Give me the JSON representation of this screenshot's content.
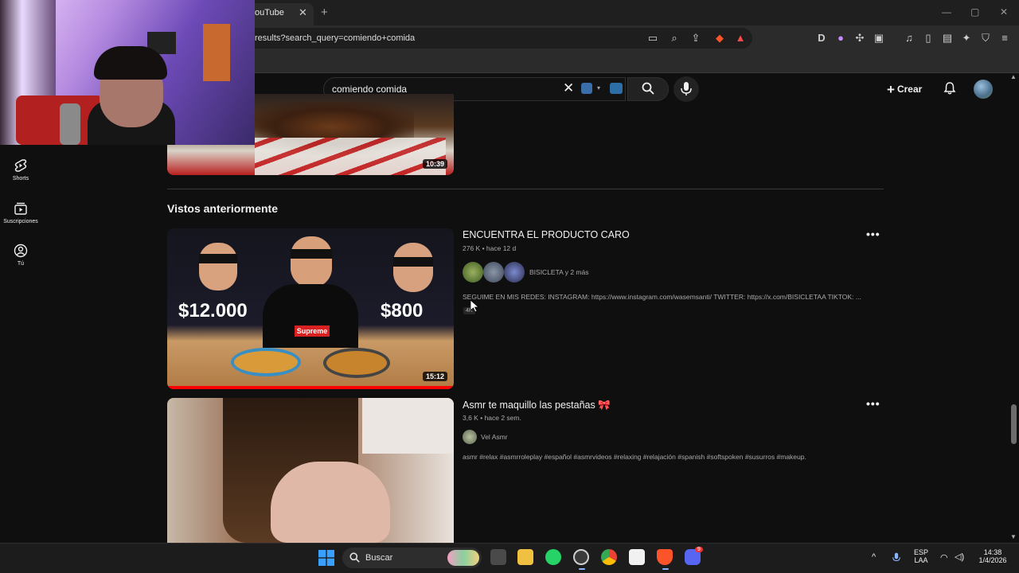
{
  "browser": {
    "tab_title": "ouTube",
    "tab_close": "✕",
    "new_tab": "+",
    "url": "results?search_query=comiendo+comida",
    "window_controls": [
      "—",
      "▢",
      "✕"
    ]
  },
  "youtube": {
    "search_value": "comiendo comida",
    "search_clear": "✕",
    "create_label": "Crear",
    "create_plus": "+",
    "sidebar": [
      {
        "label": "Shorts",
        "icon": "shorts-icon"
      },
      {
        "label": "Suscripciones",
        "icon": "subscriptions-icon"
      },
      {
        "label": "Tú",
        "icon": "you-icon"
      }
    ],
    "top_video_duration": "10:39",
    "section_title": "Vistos anteriormente",
    "videos": [
      {
        "title": "ENCUENTRA EL PRODUCTO CARO",
        "meta": "276 K • hace 12 d",
        "channel": "BISICLETA y 2 más",
        "description": "SEGUIME EN MIS REDES: INSTAGRAM: https://www.instagram.com/wasemsanti/ TWITTER: https://x.com/BISICLETAA TIKTOK: ...",
        "badge": "4K",
        "duration": "15:12",
        "thumb_left_price": "$12.000",
        "thumb_right_price": "$800",
        "thumb_shirt": "Supreme"
      },
      {
        "title": "Asmr te maquillo las pestañas 🎀",
        "meta": "3,6 K • hace 2 sem.",
        "channel": "Vel Asmr",
        "description": "asmr #relax #asmrroleplay #español #asmrvideos #relaxing #relajación #spanish #softspoken #susurros #makeup."
      }
    ],
    "more_dots": "•••"
  },
  "taskbar": {
    "search_label": "Buscar",
    "lang_top": "ESP",
    "lang_bottom": "LAA",
    "time": "14:38",
    "date": "1/4/2026",
    "discord_badge": "9",
    "tray_chevron": "^"
  },
  "colors": {
    "accent_red": "#ff0000",
    "bg": "#0f0f0f",
    "text": "#f1f1f1",
    "muted": "#aaaaaa"
  }
}
